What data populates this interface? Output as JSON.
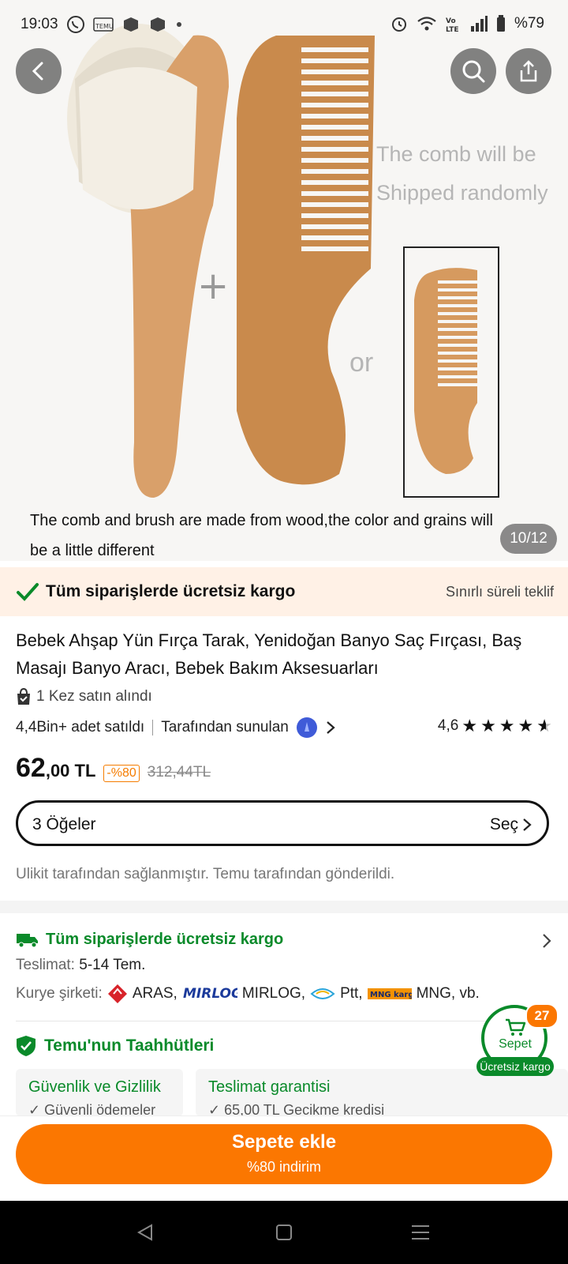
{
  "status_bar": {
    "time": "19:03",
    "battery": "%79"
  },
  "hero": {
    "image_text_1": "The comb will be",
    "image_text_2": "Shipped randomly",
    "image_or": "or",
    "image_plus": "+",
    "caption_line1": "The comb and brush are made from wood,the color and grains will",
    "caption_line2": "be a little different",
    "counter": "10/12"
  },
  "banner": {
    "text": "Tüm siparişlerde ücretsiz kargo",
    "offer": "Sınırlı süreli teklif"
  },
  "product": {
    "title": "Bebek Ahşap Yün Fırça Tarak, Yenidoğan Banyo Saç Fırçası, Baş Masajı Banyo Aracı, Bebek Bakım Aksesuarları",
    "bought": "1 Kez satın alındı",
    "sold": "4,4Bin+ adet satıldı",
    "offered_by": "Tarafından sunulan",
    "rating": "4,6",
    "rating_value": 4.6,
    "price_int": "62",
    "price_dec": ",00 TL",
    "discount": "-%80",
    "old_price": "312,44TL",
    "items_label": "3 Öğeler",
    "select_label": "Seç",
    "provided": "Ulikit tarafından sağlanmıştır. Temu tarafından gönderildi."
  },
  "shipping": {
    "title": "Tüm siparişlerde ücretsiz kargo",
    "delivery_label": "Teslimat:",
    "delivery_value": "5-14 Tem.",
    "courier_label": "Kurye şirketi:",
    "couriers": [
      "ARAS,",
      "MIRLOG,",
      "Ptt,",
      "MNG, vb."
    ]
  },
  "commitments": {
    "title": "Temu'nun Taahhütleri",
    "cards": [
      {
        "heading": "Güvenlik ve Gizlilik",
        "sub": "✓ Güvenli ödemeler"
      },
      {
        "heading": "Teslimat garantisi",
        "sub": "✓ 65,00 TL Gecikme kredisi"
      }
    ]
  },
  "cart": {
    "count": "27",
    "label": "Sepet",
    "free": "Ücretsiz kargo"
  },
  "cta": {
    "label": "Sepete ekle",
    "sub": "%80 indirim"
  },
  "colors": {
    "accent_orange": "#fb7701",
    "green": "#0a8a2a"
  }
}
